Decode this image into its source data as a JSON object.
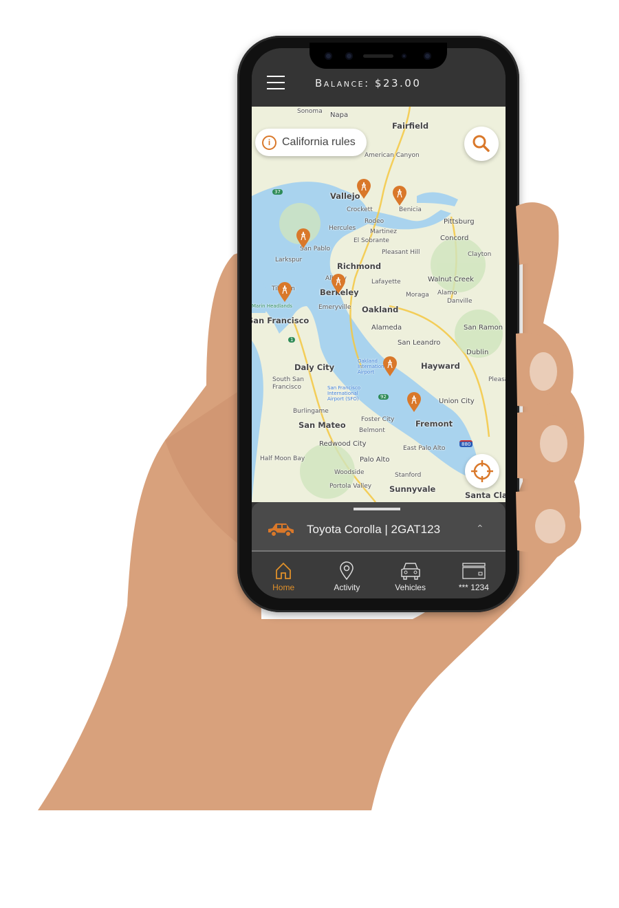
{
  "header": {
    "menu_icon": "hamburger-icon",
    "balance_label": "Balance: $23.00"
  },
  "map": {
    "rules_button": "California rules",
    "labels": [
      "Sonoma",
      "Napa",
      "Fairfield",
      "American Canyon",
      "Vallejo",
      "Crockett",
      "Rodeo",
      "Hercules",
      "Martinez",
      "Benicia",
      "Pittsburg",
      "El Sobrante",
      "Concord",
      "Pleasant Hill",
      "Clayton",
      "San Pablo",
      "Larkspur",
      "Richmond",
      "Albany",
      "Lafayette",
      "Walnut Creek",
      "Tiburon",
      "Berkeley",
      "Moraga",
      "Alamo",
      "Danville",
      "Emeryville",
      "Oakland",
      "San Francisco",
      "Alameda",
      "San Ramon",
      "San Leandro",
      "Dublin",
      "Oakland International Airport",
      "Hayward",
      "Daly City",
      "South San Francisco",
      "San Francisco International Airport (SFO)",
      "Pleasanton",
      "Union City",
      "Burlingame",
      "Foster City",
      "San Mateo",
      "Fremont",
      "Belmont",
      "Redwood City",
      "East Palo Alto",
      "Half Moon Bay",
      "Palo Alto",
      "Woodside",
      "Stanford",
      "Portola Valley",
      "Sunnyvale",
      "Santa Clara",
      "Marin Headlands"
    ],
    "highway_shields": [
      "37",
      "1",
      "92",
      "880"
    ],
    "pin_icon": "charging-station-pin-icon"
  },
  "vehicle": {
    "name": "Toyota Corolla | 2GAT123",
    "icon": "car-icon"
  },
  "nav": [
    {
      "label": "Home",
      "icon": "home-icon",
      "active": true
    },
    {
      "label": "Activity",
      "icon": "location-pin-icon",
      "active": false
    },
    {
      "label": "Vehicles",
      "icon": "car-front-icon",
      "active": false
    },
    {
      "label": "*** 1234",
      "icon": "credit-card-icon",
      "active": false
    }
  ],
  "colors": {
    "accent": "#d9782a",
    "header": "#343434",
    "nav": "#3b3b3b",
    "water": "#a9d3ee",
    "land": "#eef0dc"
  }
}
